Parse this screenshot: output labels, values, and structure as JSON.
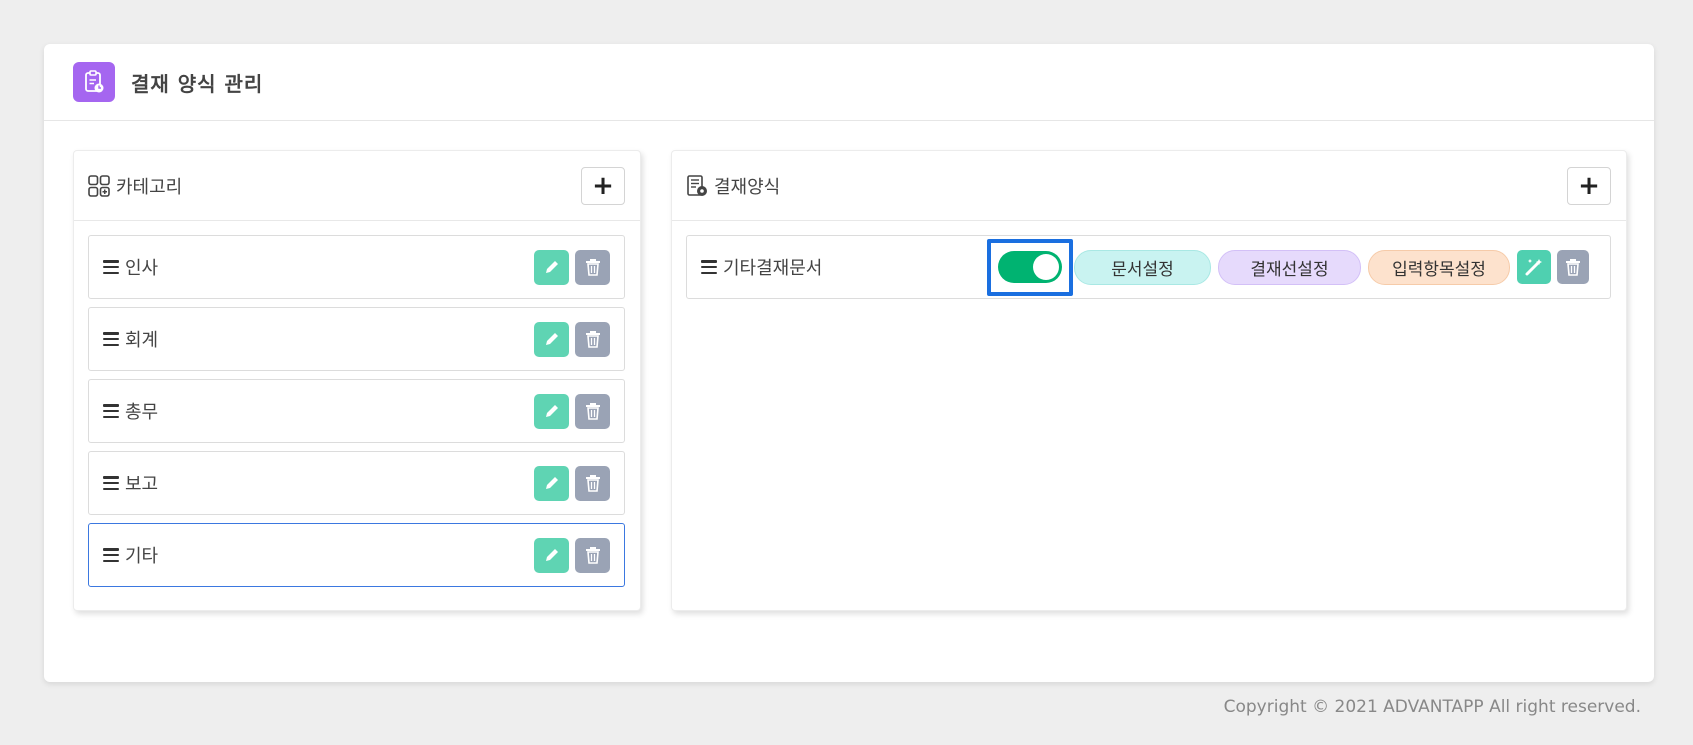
{
  "page": {
    "title": "결재 양식 관리",
    "icon": "clipboard-icon",
    "accent": "#a566f0"
  },
  "category_panel": {
    "title": "카테고리",
    "icon": "category-grid-icon",
    "add_label": "+",
    "items": [
      {
        "label": "인사"
      },
      {
        "label": "회계"
      },
      {
        "label": "총무"
      },
      {
        "label": "보고"
      },
      {
        "label": "기타",
        "selected": true
      }
    ]
  },
  "form_panel": {
    "title": "결재양식",
    "icon": "document-settings-icon",
    "add_label": "+",
    "items": [
      {
        "label": "기타결재문서",
        "enabled": true,
        "doc_settings_label": "문서설정",
        "approval_line_label": "결재선설정",
        "input_items_label": "입력항목설정"
      }
    ]
  },
  "colors": {
    "edit_button": "#5fd4b3",
    "delete_button": "#9aa3b5",
    "toggle_on": "#00b371",
    "focus_outline": "#1a6fe0"
  },
  "footer": {
    "copyright": "Copyright © 2021 ADVANTAPP All right reserved."
  }
}
